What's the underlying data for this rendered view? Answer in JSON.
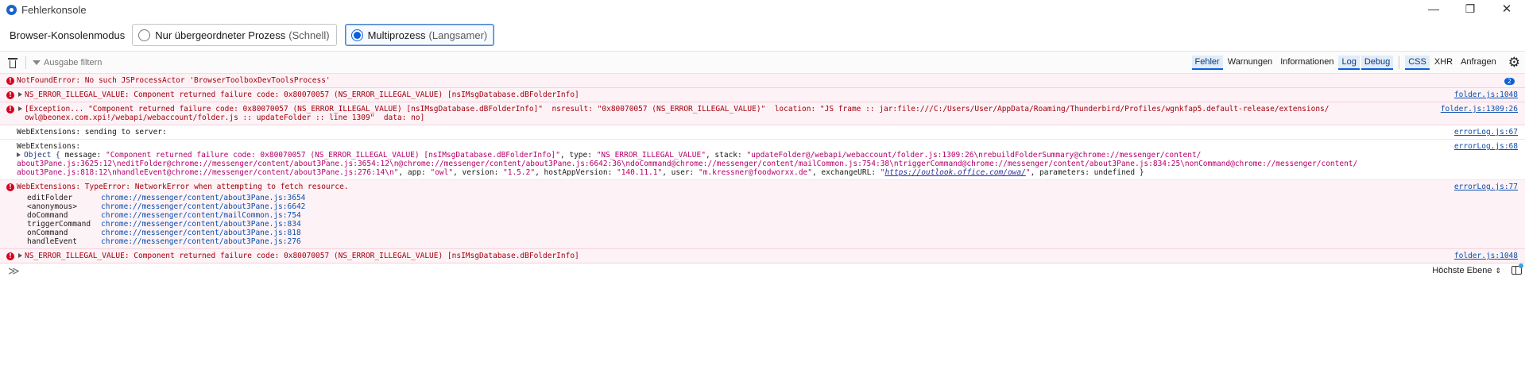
{
  "window": {
    "title": "Fehlerkonsole",
    "minimize": "—",
    "maximize": "❐",
    "close": "✕"
  },
  "mode": {
    "label": "Browser-Konsolenmodus",
    "options": [
      {
        "label": "Nur übergeordneter Prozess",
        "sub": "(Schnell)",
        "selected": false
      },
      {
        "label": "Multiprozess",
        "sub": "(Langsamer)",
        "selected": true
      }
    ]
  },
  "toolbar": {
    "filter_placeholder": "Ausgabe filtern",
    "filters": [
      {
        "label": "Fehler",
        "on": true
      },
      {
        "label": "Warnungen",
        "on": false
      },
      {
        "label": "Informationen",
        "on": false
      },
      {
        "label": "Log",
        "on": true
      },
      {
        "label": "Debug",
        "on": true
      },
      {
        "label": "CSS",
        "on": true
      },
      {
        "label": "XHR",
        "on": false
      },
      {
        "label": "Anfragen",
        "on": false
      }
    ]
  },
  "messages": {
    "m1": {
      "text": "NotFoundError: No such JSProcessActor 'BrowserToolboxDevToolsProcess'",
      "count": "2"
    },
    "m2": {
      "text": "NS_ERROR_ILLEGAL_VALUE: Component returned failure code: 0x80070057 (NS_ERROR_ILLEGAL_VALUE) [nsIMsgDatabase.dBFolderInfo]",
      "loc": "folder.js:1048"
    },
    "m3": {
      "line1": "[Exception... \"Component returned failure code: 0x80070057 (NS_ERROR_ILLEGAL_VALUE) [nsIMsgDatabase.dBFolderInfo]\"  nsresult: \"0x80070057 (NS_ERROR_ILLEGAL_VALUE)\"  location: \"JS frame :: jar:file:///C:/Users/User/AppData/Roaming/Thunderbird/Profiles/wgnkfap5.default-release/extensions/",
      "line2": "owl@beonex.com.xpi!/webapi/webaccount/folder.js :: updateFolder :: line 1309\"  data: no]",
      "loc": "folder.js:1309:26"
    },
    "m4": {
      "prefix": "WebExtensions:",
      "text": " sending to server:",
      "loc": "errorLog.js:67"
    },
    "m5": {
      "prefix": "WebExtensions:",
      "loc": "errorLog.js:68",
      "obj_label": "Object {",
      "k_message": " message: ",
      "v_message": "\"Component returned failure code: 0x80070057 (NS_ERROR_ILLEGAL_VALUE) [nsIMsgDatabase.dBFolderInfo]\"",
      "k_type": ", type: ",
      "v_type": "\"NS_ERROR_ILLEGAL_VALUE\"",
      "k_stack": ", stack: ",
      "v_stack_1": "\"updateFolder@/webapi/webaccount/folder.js:1309:26\\nrebuildFolderSummary@chrome://messenger/content/",
      "v_stack_2": "about3Pane.js:3625:12\\neditFolder@chrome://messenger/content/about3Pane.js:3654:12\\n@chrome://messenger/content/about3Pane.js:6642:36\\ndoCommand@chrome://messenger/content/mailCommon.js:754:38\\ntriggerCommand@chrome://messenger/content/about3Pane.js:834:25\\nonCommand@chrome://messenger/content/",
      "v_stack_3": "about3Pane.js:818:12\\nhandleEvent@chrome://messenger/content/about3Pane.js:276:14\\n\"",
      "k_app": ", app: ",
      "v_app": "\"owl\"",
      "k_version": ", version: ",
      "v_version": "\"1.5.2\"",
      "k_hostapp": ", hostAppVersion: ",
      "v_hostapp": "\"140.11.1\"",
      "k_user": ", user: ",
      "v_user": "\"m.kressner@foodworxx.de\"",
      "k_exchange": ", exchangeURL: ",
      "v_exchange_q1": "\"",
      "v_exchange_url": "https://outlook.office.com/owa/",
      "v_exchange_q2": "\"",
      "k_params": ", parameters: ",
      "v_params": "undefined }"
    },
    "m6": {
      "prefix": "WebExtensions:",
      "text": " TypeError: NetworkError when attempting to fetch resource.",
      "loc": "errorLog.js:77",
      "stack": [
        {
          "fn": "editFolder",
          "src": "chrome://messenger/content/about3Pane.js:3654"
        },
        {
          "fn": "<anonymous>",
          "src": "chrome://messenger/content/about3Pane.js:6642"
        },
        {
          "fn": "doCommand",
          "src": "chrome://messenger/content/mailCommon.js:754"
        },
        {
          "fn": "triggerCommand",
          "src": "chrome://messenger/content/about3Pane.js:834"
        },
        {
          "fn": "onCommand",
          "src": "chrome://messenger/content/about3Pane.js:818"
        },
        {
          "fn": "handleEvent",
          "src": "chrome://messenger/content/about3Pane.js:276"
        }
      ]
    },
    "m7": {
      "text": "NS_ERROR_ILLEGAL_VALUE: Component returned failure code: 0x80070057 (NS_ERROR_ILLEGAL_VALUE) [nsIMsgDatabase.dBFolderInfo]",
      "loc": "folder.js:1048"
    }
  },
  "input": {
    "prompt": "≫",
    "context": "Höchste Ebene",
    "context_caret": "⇕"
  },
  "colors": {
    "error_bg": "#fdf2f5",
    "error_text": "#a4000f",
    "accent": "#0b61d9"
  },
  "icons": [
    "app-logo",
    "trash-icon",
    "filter-icon",
    "gear-icon",
    "error-icon",
    "twisty-icon",
    "prompt-icon",
    "sidebar-icon"
  ]
}
